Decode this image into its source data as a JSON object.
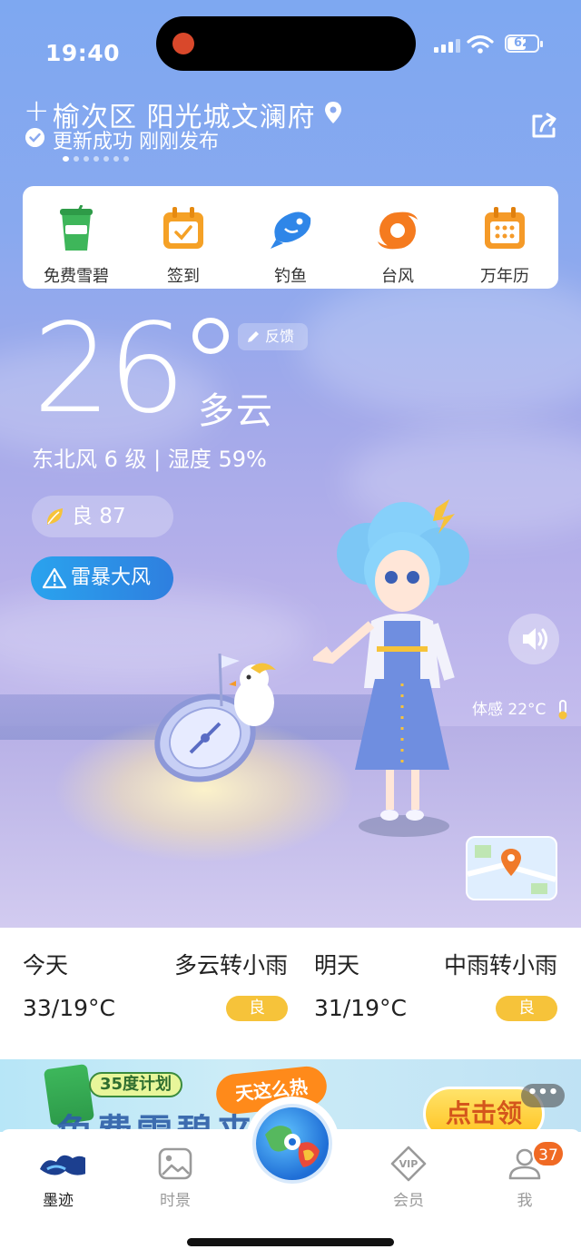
{
  "status_bar": {
    "time": "19:40",
    "battery": "62"
  },
  "location": {
    "name": "榆次区 阳光城文澜府",
    "update_status": "更新成功 刚刚发布"
  },
  "quick_actions": [
    {
      "label": "免费雪碧",
      "icon": "cup-icon",
      "color": "#3eb65a"
    },
    {
      "label": "签到",
      "icon": "calendar-check-icon",
      "color": "#f5a126"
    },
    {
      "label": "钓鱼",
      "icon": "fish-icon",
      "color": "#2f86e8"
    },
    {
      "label": "台风",
      "icon": "typhoon-icon",
      "color": "#f57b1f"
    },
    {
      "label": "万年历",
      "icon": "calendar-grid-icon",
      "color": "#f59a28"
    }
  ],
  "current": {
    "temperature": "26",
    "condition": "多云",
    "wind_humidity": "东北风 6 级 | 湿度 59%",
    "feedback_label": "反馈",
    "aqi_label": "良 87",
    "alert_label": "雷暴大风",
    "feels_like": "体感 22°C"
  },
  "forecast": [
    {
      "day": "今天",
      "condition": "多云转小雨",
      "temp": "33/19°C",
      "aqi": "良"
    },
    {
      "day": "明天",
      "condition": "中雨转小雨",
      "temp": "31/19°C",
      "aqi": "良"
    }
  ],
  "banner": {
    "tag": "35度计划",
    "hot_label": "天这么热",
    "headline": "免费雪碧来了",
    "cta": "点击领"
  },
  "tabs": [
    {
      "label": "墨迹",
      "active": true
    },
    {
      "label": "时景",
      "active": false
    },
    {
      "label": "会员",
      "active": false
    },
    {
      "label": "我",
      "active": false
    }
  ],
  "profile_badge": "37",
  "colors": {
    "accent_yellow": "#f6c33a",
    "alert_blue": "#2e8fe8",
    "sky_top": "#7ea8f1"
  }
}
